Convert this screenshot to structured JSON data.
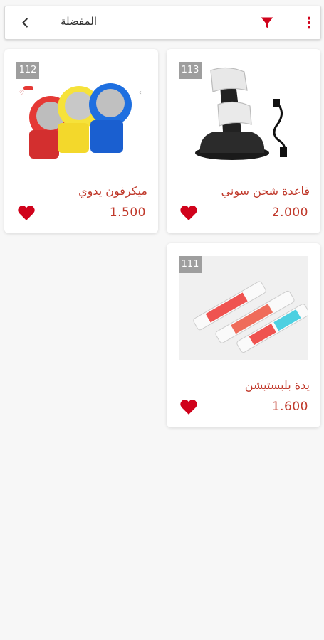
{
  "header": {
    "title": "المفضلة",
    "back_icon": "chevron-left-icon",
    "filter_icon": "filter-icon",
    "more_icon": "more-vertical-icon"
  },
  "colors": {
    "accent": "#c0392b",
    "filter": "#d0021b",
    "badge": "#9e9e9e"
  },
  "products": [
    {
      "id": "113",
      "name": "قاعدة شحن سوني",
      "price": "2.000",
      "favorite_icon": "heart-icon"
    },
    {
      "id": "112",
      "name": "ميكرفون يدوي",
      "price": "1.500",
      "favorite_icon": "heart-icon"
    },
    {
      "id": "111",
      "name": "يدة بلبستيشن",
      "price": "1.600",
      "favorite_icon": "heart-icon"
    }
  ]
}
